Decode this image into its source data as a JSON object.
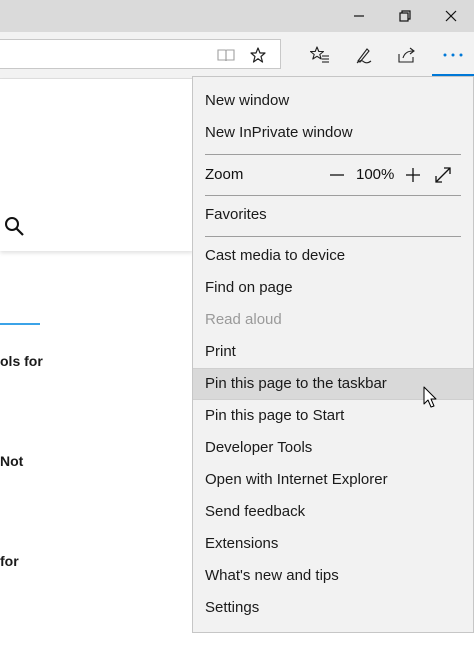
{
  "page": {
    "fragments": [
      "ols for",
      "Not",
      "for"
    ]
  },
  "menu": {
    "group1": [
      "New window",
      "New InPrivate window"
    ],
    "zoom": {
      "label": "Zoom",
      "value": "100%"
    },
    "favorites": "Favorites",
    "group2": [
      "Cast media to device",
      "Find on page",
      "Read aloud",
      "Print",
      "Pin this page to the taskbar",
      "Pin this page to Start",
      "Developer Tools",
      "Open with Internet Explorer",
      "Send feedback",
      "Extensions",
      "What's new and tips",
      "Settings"
    ],
    "disabled_item": "Read aloud",
    "hovered_item": "Pin this page to the taskbar"
  },
  "colors": {
    "accent": "#0078d7",
    "menu_bg": "#f2f2f2",
    "hover_bg": "#d9d9d9"
  }
}
